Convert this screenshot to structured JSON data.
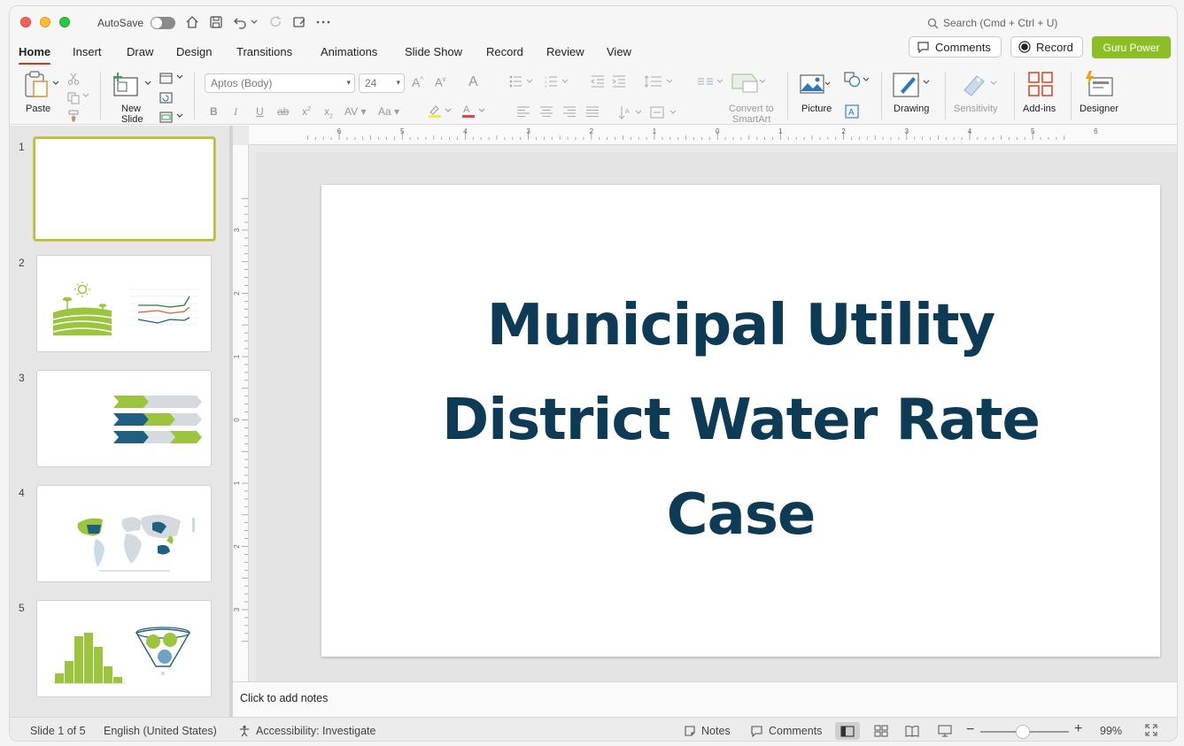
{
  "titlebar": {
    "autosave_label": "AutoSave",
    "search_placeholder": "Search (Cmd + Ctrl + U)"
  },
  "tabs": [
    {
      "label": "Home",
      "active": true
    },
    {
      "label": "Insert"
    },
    {
      "label": "Draw"
    },
    {
      "label": "Design"
    },
    {
      "label": "Transitions"
    },
    {
      "label": "Animations"
    },
    {
      "label": "Slide Show"
    },
    {
      "label": "Record"
    },
    {
      "label": "Review"
    },
    {
      "label": "View"
    }
  ],
  "header_buttons": {
    "comments": "Comments",
    "record": "Record",
    "guru": "Guru Power"
  },
  "ribbon": {
    "paste": "Paste",
    "new_slide_1": "New",
    "new_slide_2": "Slide",
    "font_name": "Aptos (Body)",
    "font_size": "24",
    "convert_1": "Convert to",
    "convert_2": "SmartArt",
    "picture": "Picture",
    "drawing": "Drawing",
    "sensitivity": "Sensitivity",
    "addins": "Add-ins",
    "designer": "Designer"
  },
  "thumbnails": [
    {
      "number": "1"
    },
    {
      "number": "2"
    },
    {
      "number": "3"
    },
    {
      "number": "4"
    },
    {
      "number": "5"
    }
  ],
  "slide": {
    "title_line1": "Municipal Utility",
    "title_line2": "District Water Rate",
    "title_line3": "Case"
  },
  "ruler": {
    "h_ticks": [
      "6",
      "5",
      "4",
      "3",
      "2",
      "1",
      "0",
      "1",
      "2",
      "3",
      "4",
      "5",
      "6"
    ],
    "v_ticks": [
      "3",
      "2",
      "1",
      "0",
      "1",
      "2",
      "3"
    ]
  },
  "notes": {
    "placeholder": "Click to add notes"
  },
  "status": {
    "slide_of": "Slide 1 of 5",
    "language": "English (United States)",
    "accessibility": "Accessibility: Investigate",
    "notes": "Notes",
    "comments": "Comments",
    "zoom": "99%"
  },
  "colors": {
    "accent_tab": "#c43e1c",
    "guru_green": "#8cbf26",
    "title_navy": "#0d3a54",
    "lime": "#9bc53d",
    "teal": "#1f5f82"
  }
}
